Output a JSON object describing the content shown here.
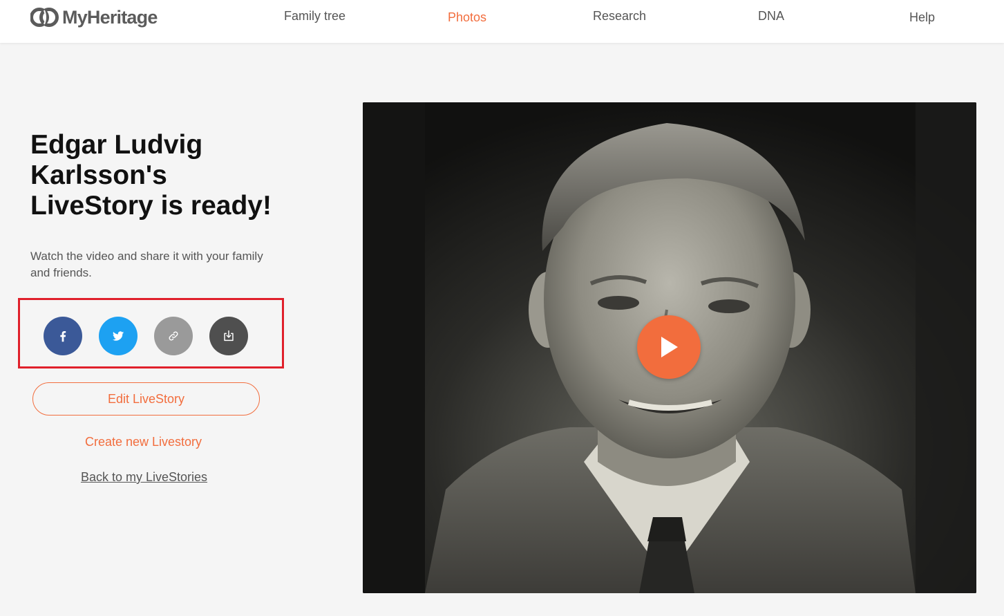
{
  "brand": {
    "name": "MyHeritage",
    "accent_color": "#f26d3d"
  },
  "nav": {
    "items": [
      {
        "label": "Family tree",
        "active": false
      },
      {
        "label": "Photos",
        "active": true
      },
      {
        "label": "Research",
        "active": false
      },
      {
        "label": "DNA",
        "active": false
      },
      {
        "label": "Help",
        "active": false
      }
    ]
  },
  "main": {
    "title": "Edgar Ludvig\nKarlsson's\nLiveStory  is ready!",
    "subtitle": "Watch the video and share it with your family and friends.",
    "share_buttons": [
      {
        "icon": "facebook-icon",
        "color": "#3b5998"
      },
      {
        "icon": "twitter-icon",
        "color": "#1da1f2"
      },
      {
        "icon": "link-icon",
        "color": "#9a9a9a"
      },
      {
        "icon": "download-icon",
        "color": "#4f4f4f"
      }
    ],
    "edit_label": "Edit LiveStory",
    "create_label": "Create new Livestory",
    "back_label": "Back to my LiveStories"
  },
  "video": {
    "play_icon": "play-icon",
    "play_color": "#f26d3d"
  }
}
